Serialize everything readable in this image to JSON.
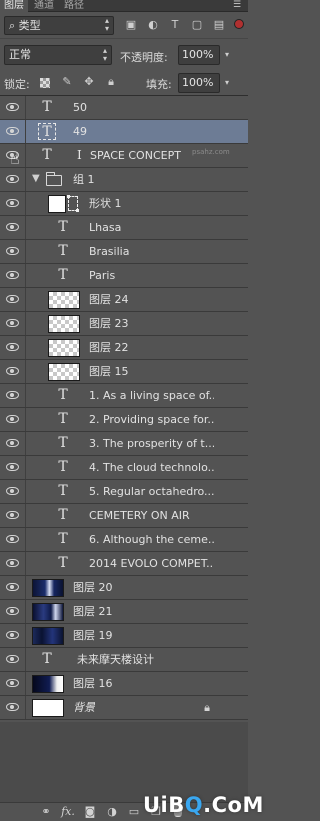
{
  "tabs": [
    {
      "label": "图层",
      "active": true
    },
    {
      "label": "通道",
      "active": false
    },
    {
      "label": "路径",
      "active": false
    }
  ],
  "filter": {
    "search_icon": "search-icon",
    "kind_label": "类型",
    "icons": [
      "image-filter-icon",
      "adjustment-filter-icon",
      "type-filter-icon",
      "shape-filter-icon",
      "smart-object-filter-icon"
    ]
  },
  "blend": {
    "mode": "正常",
    "opacity_label": "不透明度:",
    "opacity_value": "100%"
  },
  "lock": {
    "label": "锁定:",
    "icons": [
      "lock-transparent-icon",
      "lock-image-icon",
      "lock-position-icon",
      "lock-all-icon"
    ],
    "fill_label": "填充:",
    "fill_value": "100%"
  },
  "layers": [
    {
      "name": "50",
      "kind": "text",
      "indent": 0,
      "selected": false
    },
    {
      "name": "49",
      "kind": "text",
      "indent": 0,
      "selected": true
    },
    {
      "name": "SPACE CONCEPT",
      "kind": "text",
      "indent": 0,
      "selected": false
    },
    {
      "name": "组 1",
      "kind": "group",
      "indent": 0,
      "selected": false
    },
    {
      "name": "形状 1",
      "kind": "shape",
      "indent": 1,
      "selected": false
    },
    {
      "name": "Lhasa",
      "kind": "text",
      "indent": 1,
      "selected": false
    },
    {
      "name": "Brasilia",
      "kind": "text",
      "indent": 1,
      "selected": false
    },
    {
      "name": "Paris",
      "kind": "text",
      "indent": 1,
      "selected": false
    },
    {
      "name": "图层 24",
      "kind": "pixel",
      "indent": 1,
      "selected": false
    },
    {
      "name": "图层 23",
      "kind": "pixel",
      "indent": 1,
      "selected": false
    },
    {
      "name": "图层 22",
      "kind": "pixel",
      "indent": 1,
      "selected": false
    },
    {
      "name": "图层 15",
      "kind": "pixel",
      "indent": 1,
      "selected": false
    },
    {
      "name": "1. As a living space of...",
      "kind": "text",
      "indent": 1,
      "selected": false
    },
    {
      "name": "2. Providing space for...",
      "kind": "text",
      "indent": 1,
      "selected": false
    },
    {
      "name": "3. The prosperity of t...",
      "kind": "text",
      "indent": 1,
      "selected": false
    },
    {
      "name": "4. The cloud technolo...",
      "kind": "text",
      "indent": 1,
      "selected": false
    },
    {
      "name": "5. Regular octahedro...",
      "kind": "text",
      "indent": 1,
      "selected": false
    },
    {
      "name": "CEMETERY ON AIR",
      "kind": "text",
      "indent": 1,
      "selected": false
    },
    {
      "name": "6. Although the ceme...",
      "kind": "text",
      "indent": 1,
      "selected": false
    },
    {
      "name": "2014 EVOLO COMPET...",
      "kind": "text",
      "indent": 1,
      "selected": false
    },
    {
      "name": "图层 20",
      "kind": "photo",
      "indent": 0,
      "selected": false
    },
    {
      "name": "图层 21",
      "kind": "photo",
      "indent": 0,
      "selected": false
    },
    {
      "name": "图层 19",
      "kind": "photo",
      "indent": 0,
      "selected": false
    },
    {
      "name": "未来摩天楼设计",
      "kind": "text",
      "indent": 0,
      "selected": false
    },
    {
      "name": "图层 16",
      "kind": "photo",
      "indent": 0,
      "selected": false
    },
    {
      "name": "背景",
      "kind": "background",
      "indent": 0,
      "selected": false
    }
  ],
  "watermark": {
    "part1": "UiB",
    "q": "Q",
    "part2": ".CoM",
    "sub": "psahz.com"
  },
  "bottombar": {
    "icons": [
      "link-layers-icon",
      "fx-icon",
      "add-mask-icon",
      "adjustment-layer-icon",
      "new-group-icon",
      "new-layer-icon",
      "delete-layer-icon"
    ],
    "fx_label": "fx."
  }
}
